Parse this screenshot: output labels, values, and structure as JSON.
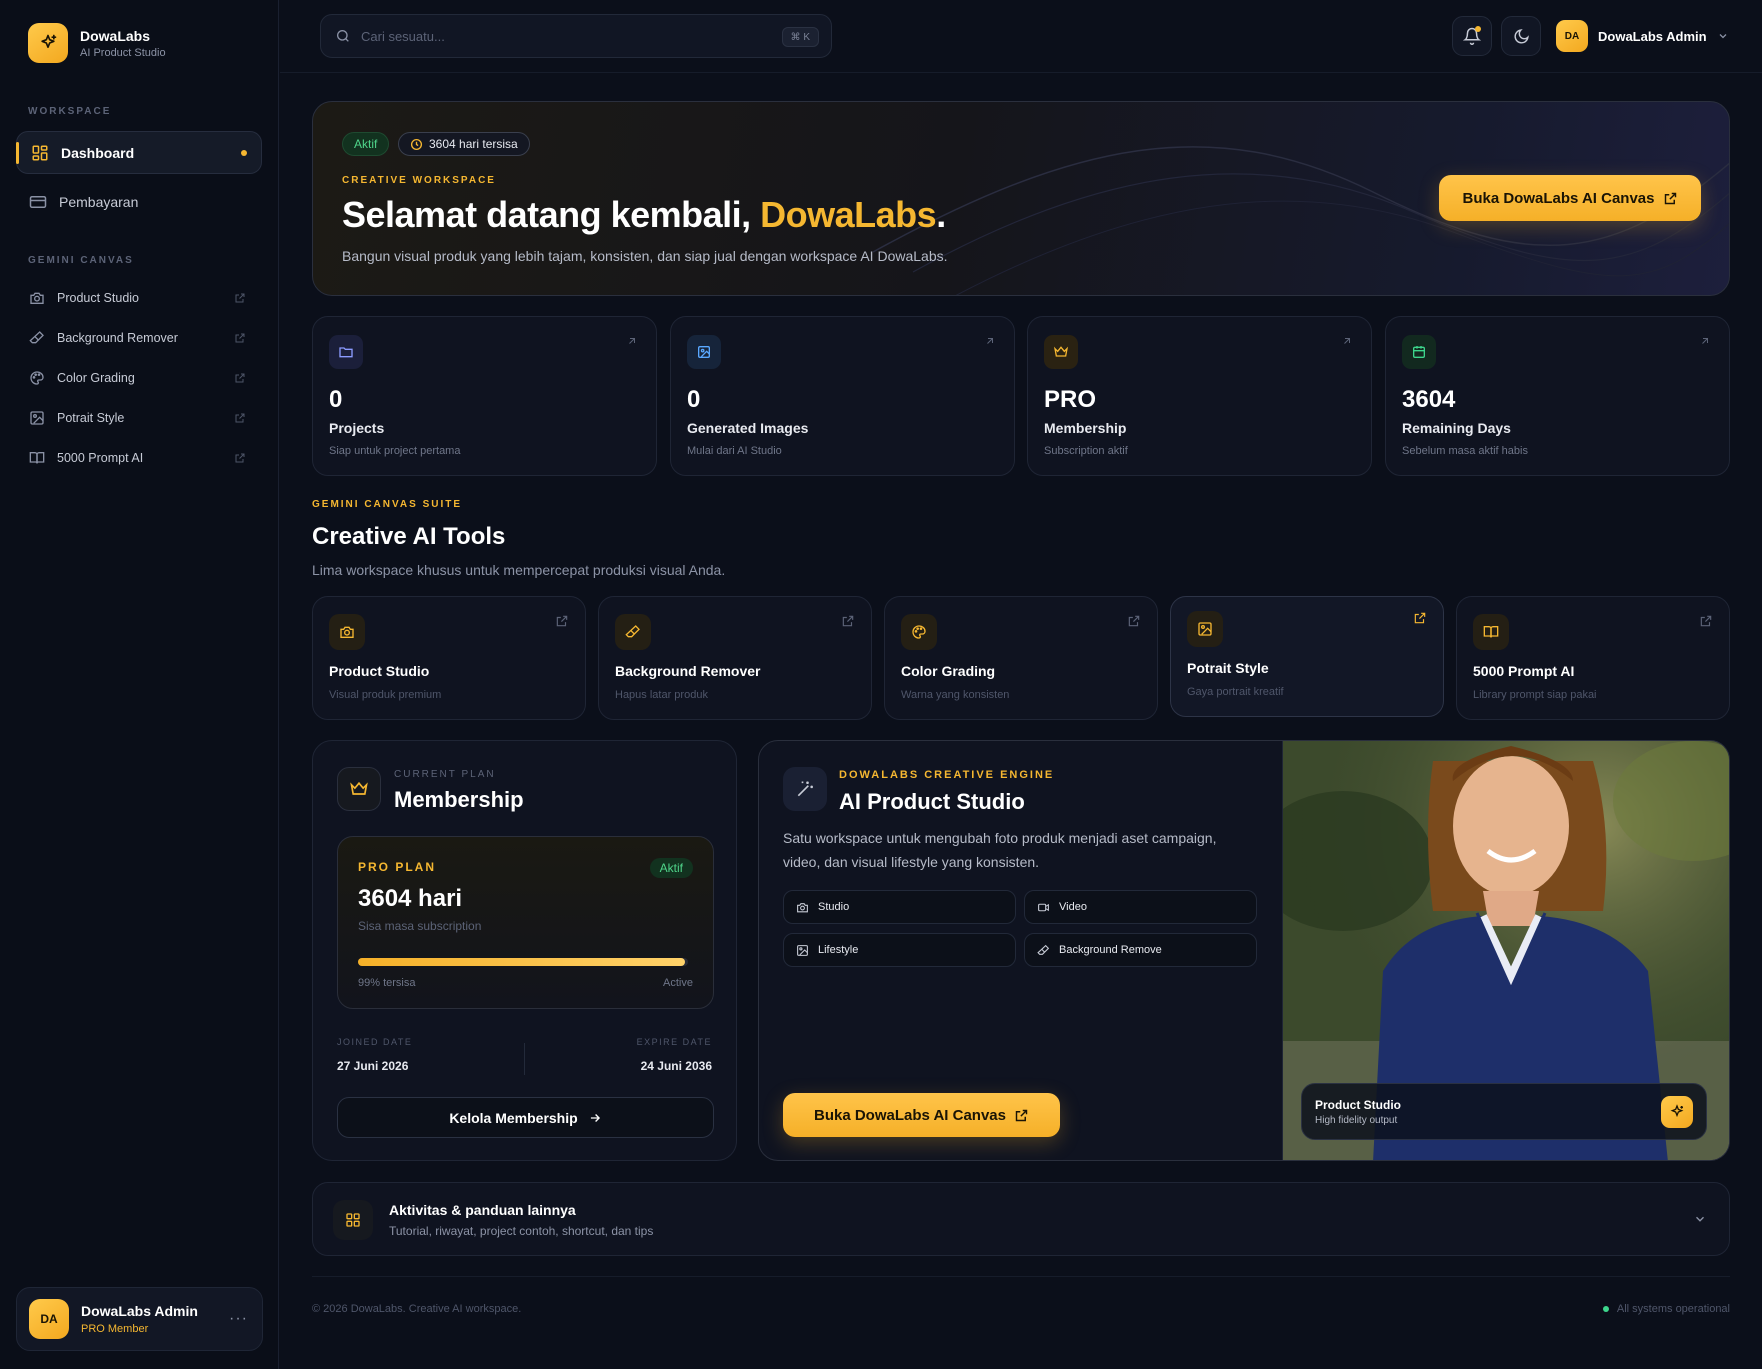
{
  "brand": {
    "name": "DowaLabs",
    "subtitle": "AI Product Studio"
  },
  "sidebar": {
    "workspace_heading": "WORKSPACE",
    "workspace_items": [
      {
        "label": "Dashboard",
        "icon": "dashboard-icon",
        "active": true
      },
      {
        "label": "Pembayaran",
        "icon": "credit-card-icon"
      }
    ],
    "canvas_heading": "GEMINI CANVAS",
    "canvas_items": [
      {
        "label": "Product Studio",
        "icon": "camera-icon"
      },
      {
        "label": "Background Remover",
        "icon": "eraser-icon"
      },
      {
        "label": "Color Grading",
        "icon": "palette-icon"
      },
      {
        "label": "Potrait Style",
        "icon": "image-icon"
      },
      {
        "label": "5000 Prompt AI",
        "icon": "book-icon"
      }
    ],
    "user": {
      "initials": "DA",
      "name": "DowaLabs Admin",
      "role": "PRO Member"
    }
  },
  "topbar": {
    "search_placeholder": "Cari sesuatu...",
    "shortcut": "⌘ K",
    "user_initials": "DA",
    "user_name": "DowaLabs Admin"
  },
  "hero": {
    "status": "Aktif",
    "days_badge": "3604 hari tersisa",
    "eyebrow": "CREATIVE WORKSPACE",
    "title_prefix": "Selamat datang kembali, ",
    "title_accent": "DowaLabs",
    "title_suffix": ".",
    "description": "Bangun visual produk yang lebih tajam, konsisten, dan siap jual dengan workspace AI DowaLabs.",
    "cta": "Buka DowaLabs AI Canvas"
  },
  "stats": [
    {
      "value": "0",
      "label": "Projects",
      "sub": "Siap untuk project pertama",
      "icon": "folder-icon",
      "color": "#7c8cff"
    },
    {
      "value": "0",
      "label": "Generated Images",
      "sub": "Mulai dari AI Studio",
      "icon": "images-icon",
      "color": "#5aa8ff"
    },
    {
      "value": "PRO",
      "label": "Membership",
      "sub": "Subscription aktif",
      "icon": "crown-icon",
      "color": "#f5b731"
    },
    {
      "value": "3604",
      "label": "Remaining Days",
      "sub": "Sebelum masa aktif habis",
      "icon": "calendar-icon",
      "color": "#3dd68c"
    }
  ],
  "tools_section": {
    "eyebrow": "GEMINI CANVAS SUITE",
    "title": "Creative AI Tools",
    "description": "Lima workspace khusus untuk mempercepat produksi visual Anda."
  },
  "tools": [
    {
      "name": "Product Studio",
      "sub": "Visual produk premium",
      "icon": "camera-icon"
    },
    {
      "name": "Background Remover",
      "sub": "Hapus latar produk",
      "icon": "eraser-icon"
    },
    {
      "name": "Color Grading",
      "sub": "Warna yang konsisten",
      "icon": "palette-icon"
    },
    {
      "name": "Potrait Style",
      "sub": "Gaya portrait kreatif",
      "icon": "image-icon"
    },
    {
      "name": "5000 Prompt AI",
      "sub": "Library prompt siap pakai",
      "icon": "book-icon"
    }
  ],
  "membership": {
    "eyebrow": "CURRENT PLAN",
    "title": "Membership",
    "plan_label": "PRO PLAN",
    "plan_status": "Aktif",
    "days": "3604 hari",
    "days_sub": "Sisa masa subscription",
    "progress_fraction": 0.99,
    "progress_text": "99% tersisa",
    "progress_status": "Active",
    "joined_caption": "JOINED DATE",
    "joined_date": "27 Juni 2026",
    "expire_caption": "EXPIRE DATE",
    "expire_date": "24 Juni 2036",
    "manage_button": "Kelola Membership"
  },
  "studio": {
    "eyebrow": "DOWALABS CREATIVE ENGINE",
    "title": "AI Product Studio",
    "description": "Satu workspace untuk mengubah foto produk menjadi aset campaign, video, dan visual lifestyle yang konsisten.",
    "chips": [
      {
        "label": "Studio",
        "icon": "camera-icon"
      },
      {
        "label": "Video",
        "icon": "video-icon"
      },
      {
        "label": "Lifestyle",
        "icon": "image-icon"
      },
      {
        "label": "Background Remove",
        "icon": "eraser-icon"
      }
    ],
    "cta": "Buka DowaLabs AI Canvas",
    "photo_caption_title": "Product Studio",
    "photo_caption_sub": "High fidelity output"
  },
  "accordion": {
    "title": "Aktivitas & panduan lainnya",
    "subtitle": "Tutorial, riwayat, project contoh, shortcut, dan tips"
  },
  "footer": {
    "copyright": "© 2026 DowaLabs. Creative AI workspace.",
    "status": "All systems operational"
  }
}
